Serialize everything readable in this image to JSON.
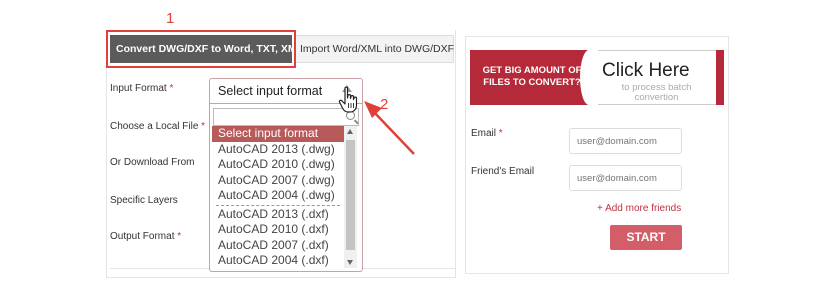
{
  "annotations": {
    "step1": "1",
    "step2": "2"
  },
  "tabs": [
    {
      "label": "Convert DWG/DXF to Word, TXT, XML",
      "active": true
    },
    {
      "label": "Import Word/XML into DWG/DXF",
      "active": false
    }
  ],
  "form": {
    "required_mark": "*",
    "labels": {
      "input_format": "Input Format",
      "local_file": "Choose a Local File",
      "download_from": "Or Download From",
      "specific_layers": "Specific Layers",
      "output_format": "Output Format"
    },
    "select": {
      "value": "Select input format",
      "search_value": "",
      "options_dwg": [
        "Select input format",
        "AutoCAD 2013 (.dwg)",
        "AutoCAD 2010 (.dwg)",
        "AutoCAD 2007 (.dwg)",
        "AutoCAD 2004 (.dwg)"
      ],
      "options_dxf": [
        "AutoCAD 2013 (.dxf)",
        "AutoCAD 2010 (.dxf)",
        "AutoCAD 2007 (.dxf)",
        "AutoCAD 2004 (.dxf)"
      ],
      "selected_index": 0
    }
  },
  "banner": {
    "left_line1": "GET BIG AMOUNT OF",
    "left_line2": "FILES TO CONVERT?",
    "title": "Click Here",
    "subtitle": "to process batch convertion"
  },
  "batch_form": {
    "email_label": "Email",
    "friends_email_label": "Friend's Email",
    "email_placeholder": "user@domain.com",
    "friend_placeholder": "user@domain.com",
    "add_more": "+ Add more friends",
    "start": "START"
  },
  "colors": {
    "accent": "#b52a3a",
    "annotation": "#e0403a",
    "start_button": "#d35d68",
    "tab_active": "#5b5b5b"
  }
}
